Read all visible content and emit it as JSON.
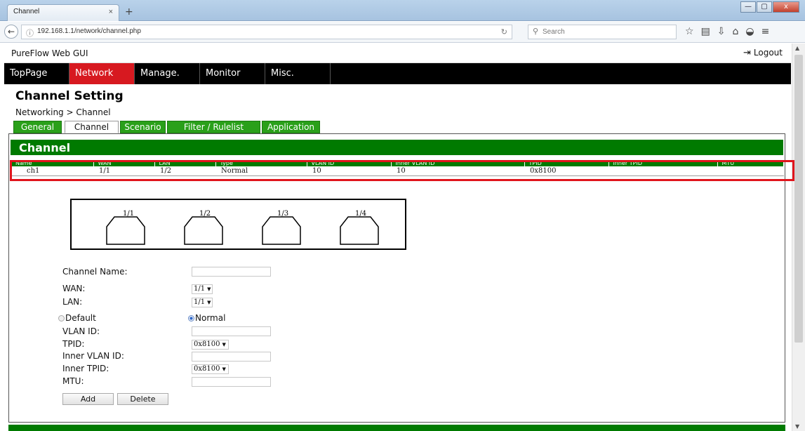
{
  "browser": {
    "tab_title": "Channel",
    "tab_close": "×",
    "new_tab": "+",
    "url": "192.168.1.1/network/channel.php",
    "search_placeholder": "Search",
    "window_controls": [
      "—",
      "▢",
      "x"
    ]
  },
  "app": {
    "title": "PureFlow Web GUI",
    "logout_label": "Logout"
  },
  "menu": [
    {
      "label": "TopPage",
      "active": false
    },
    {
      "label": "Network",
      "active": true
    },
    {
      "label": "Manage.",
      "active": false
    },
    {
      "label": "Monitor",
      "active": false
    },
    {
      "label": "Misc.",
      "active": false
    }
  ],
  "page": {
    "title": "Channel Setting",
    "breadcrumb": "Networking > Channel"
  },
  "subtabs": [
    {
      "label": "General",
      "active": false
    },
    {
      "label": "Channel",
      "active": true
    },
    {
      "label": "Scenario",
      "active": false
    },
    {
      "label": "Filter / Rulelist",
      "active": false
    },
    {
      "label": "Application",
      "active": false
    }
  ],
  "panel": {
    "title": "Channel",
    "table": {
      "headers": [
        "Name",
        "WAN",
        "LAN",
        "Type",
        "VLAN ID",
        "Inner VLAN ID",
        "TPID",
        "Inner TPID",
        "MTU"
      ],
      "rows": [
        [
          "ch1",
          "1/1",
          "1/2",
          "Normal",
          "10",
          "10",
          "0x8100",
          "",
          ""
        ]
      ]
    },
    "ports": [
      "1/1",
      "1/2",
      "1/3",
      "1/4"
    ]
  },
  "form": {
    "channel_name_label": "Channel Name:",
    "channel_name_value": "",
    "wan_label": "WAN:",
    "wan_value": "1/1",
    "lan_label": "LAN:",
    "lan_value": "1/1",
    "type_default_label": "Default",
    "type_normal_label": "Normal",
    "type_selected": "Normal",
    "vlan_id_label": "VLAN ID:",
    "vlan_id_value": "",
    "tpid_label": "TPID:",
    "tpid_value": "0x8100",
    "inner_vlan_id_label": "Inner VLAN ID:",
    "inner_vlan_id_value": "",
    "inner_tpid_label": "Inner TPID:",
    "inner_tpid_value": "0x8100",
    "mtu_label": "MTU:",
    "mtu_value": "",
    "add_label": "Add",
    "delete_label": "Delete"
  },
  "colors": {
    "menu_active": "#d71920",
    "panel_green": "#007a00",
    "tab_green": "#2aa01a",
    "highlight_red": "#e0151c"
  }
}
